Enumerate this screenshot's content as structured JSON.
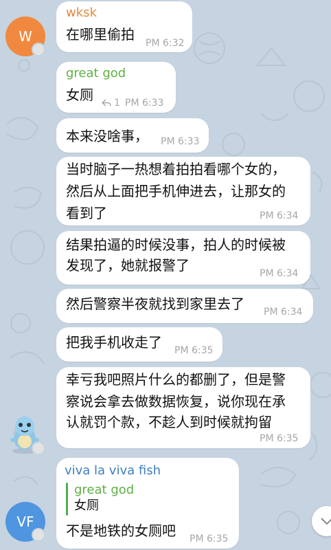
{
  "messages": [
    {
      "sender": "wksk",
      "text": "在哪里偷拍",
      "time": "PM 6:32"
    },
    {
      "sender": "great god",
      "text": "女厕",
      "reply_count": "1",
      "time": "PM 6:33"
    },
    {
      "text": "本来没啥事，",
      "time": "PM 6:33"
    },
    {
      "lines": [
        "当时脑子一热想着拍拍看哪个女的，",
        "然后从上面把手机伸进去，让那女的",
        "看到了"
      ],
      "time": "PM 6:34"
    },
    {
      "lines": [
        "结果拍逼的时候没事，拍人的时候被",
        "发现了，她就报警了"
      ],
      "time": "PM 6:34"
    },
    {
      "text": "然后警察半夜就找到家里去了",
      "time": "PM 6:34"
    },
    {
      "text": "把我手机收走了",
      "time": "PM 6:35"
    },
    {
      "lines": [
        "幸亏我吧照片什么的都删了，但是警",
        "察说会拿去做数据恢复，说你现在承",
        "认就罚个款，不趁人到时候就拘留"
      ],
      "time": "PM 6:35"
    },
    {
      "sender": "viva la viva fish",
      "quote": {
        "sender": "great god",
        "text": "女厕"
      },
      "text": "不是地铁的女厕吧",
      "time": "PM 6:35"
    }
  ],
  "avatars": {
    "wksk": {
      "initial": "W",
      "color": "#f0893f"
    },
    "viva": {
      "initial": "VF",
      "color": "#4f95e0"
    }
  },
  "colors": {
    "wksk_name": "#e08a3c",
    "greatgod_name": "#5fb043",
    "viva_name": "#3d7fbf",
    "quote_accent": "#4caf50"
  },
  "icons": {
    "reply": "reply-arrow-icon",
    "scroll_down": "chevron-down-icon"
  }
}
